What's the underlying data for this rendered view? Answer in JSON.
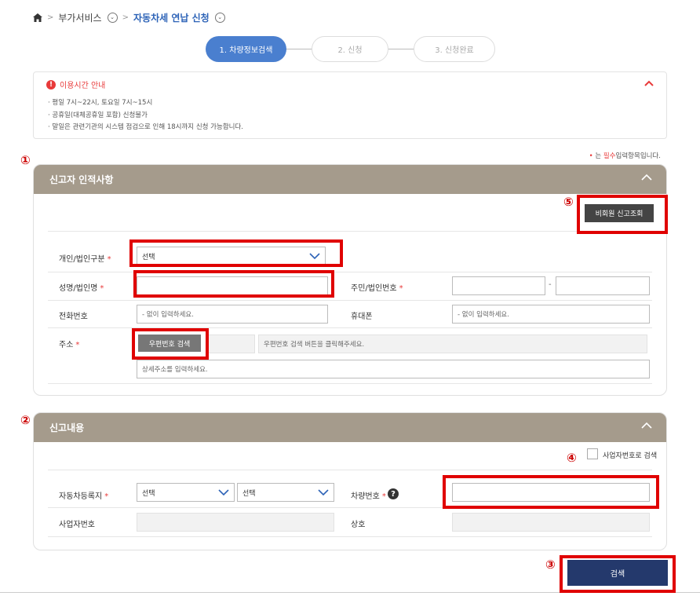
{
  "breadcrumb": {
    "home_icon": "home-icon",
    "items": [
      "부가서비스",
      "자동차세 연납 신청"
    ]
  },
  "steps": [
    {
      "label": "1. 차량정보검색",
      "active": true
    },
    {
      "label": "2. 신청",
      "active": false
    },
    {
      "label": "3. 신청완료",
      "active": false
    }
  ],
  "notice": {
    "title": "이용시간 안내",
    "lines": [
      "· 평일 7시~22시, 토요일 7시~15시",
      "· 공휴일(대체공휴일 포함) 신청불가",
      "· 말일은 관련기관의 시스템 점검으로 인해 18시까지 신청 가능합니다."
    ]
  },
  "required_note": {
    "mark": "•",
    "prefix": "는",
    "highlight": "필수",
    "suffix": "입력항목입니다."
  },
  "markers": {
    "m1": "①",
    "m2": "②",
    "m3": "③",
    "m4": "④",
    "m5": "⑤"
  },
  "reporter": {
    "title": "신고자 인적사항",
    "non_member_button": "비회원 신고조회",
    "type_label": "개인/법인구분",
    "type_value": "선택",
    "name_label": "성명/법인명",
    "name_value": "",
    "id_label": "주민/법인번호",
    "id_sep": "-",
    "phone_label": "전화번호",
    "phone_placeholder": "- 없이 입력하세요.",
    "mobile_label": "휴대폰",
    "mobile_placeholder": "- 없이 입력하세요.",
    "address_label": "주소",
    "zip_button": "우편번호 검색",
    "address_placeholder": "우편번호 검색 버튼을 클릭해주세요.",
    "detail_placeholder": "상세주소를 입력하세요.",
    "required_mark": "*"
  },
  "report": {
    "title": "신고내용",
    "biz_search_label": "사업자번호로 검색",
    "region_label": "자동차등록지",
    "region_select1": "선택",
    "region_select2": "선택",
    "car_no_label": "차량번호",
    "car_no_value": "",
    "biz_no_label": "사업자번호",
    "company_label": "상호",
    "required_mark": "*"
  },
  "search_button": "검색",
  "colors": {
    "accent_blue": "#4a7fcf",
    "section_header": "#a59b8c",
    "navy": "#24396c",
    "highlight_red": "#e00000"
  }
}
